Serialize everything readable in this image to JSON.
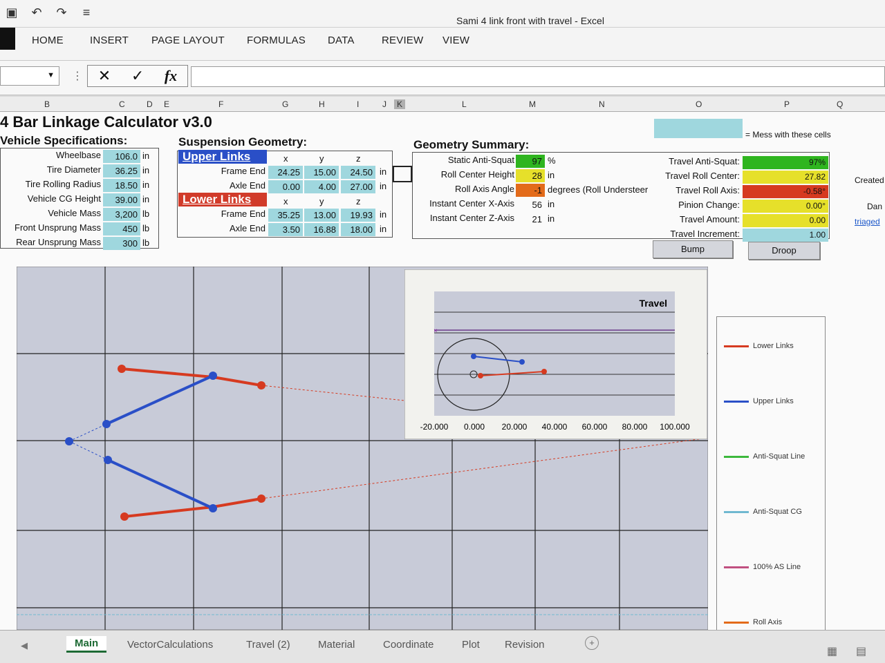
{
  "window": {
    "title": "Sami 4 link front with travel - Excel",
    "qat": [
      "save-icon",
      "undo-icon",
      "redo-icon",
      "customize-icon"
    ]
  },
  "ribbon": {
    "tabs": [
      "HOME",
      "INSERT",
      "PAGE LAYOUT",
      "FORMULAS",
      "DATA",
      "REVIEW",
      "VIEW"
    ]
  },
  "formula_bar": {
    "fx_label": "fx",
    "value": ""
  },
  "columns": [
    "B",
    "C",
    "D",
    "E",
    "F",
    "G",
    "H",
    "I",
    "J",
    "K",
    "L",
    "M",
    "N",
    "O",
    "P",
    "Q"
  ],
  "calculator": {
    "title": "4 Bar Linkage Calculator v3.0",
    "legend_note": "= Mess with these cells",
    "vehicle": {
      "heading": "Vehicle Specifications:",
      "rows": [
        {
          "label": "Wheelbase",
          "value": "106.0",
          "unit": "in"
        },
        {
          "label": "Tire Diameter",
          "value": "36.25",
          "unit": "in"
        },
        {
          "label": "Tire Rolling Radius",
          "value": "18.50",
          "unit": "in"
        },
        {
          "label": "Vehicle CG Height",
          "value": "39.00",
          "unit": "in"
        },
        {
          "label": "Vehicle Mass",
          "value": "3,200",
          "unit": "lb"
        },
        {
          "label": "Front Unsprung Mass",
          "value": "450",
          "unit": "lb"
        },
        {
          "label": "Rear Unsprung Mass",
          "value": "300",
          "unit": "lb"
        }
      ]
    },
    "suspension": {
      "heading": "Suspension Geometry:",
      "upper": {
        "title": "Upper Links",
        "axes": [
          "x",
          "y",
          "z"
        ],
        "rows": [
          {
            "label": "Frame End",
            "values": [
              "24.25",
              "15.00",
              "24.50"
            ],
            "unit": "in"
          },
          {
            "label": "Axle End",
            "values": [
              "0.00",
              "4.00",
              "27.00"
            ],
            "unit": "in"
          }
        ]
      },
      "lower": {
        "title": "Lower Links",
        "axes": [
          "x",
          "y",
          "z"
        ],
        "rows": [
          {
            "label": "Frame End",
            "values": [
              "35.25",
              "13.00",
              "19.93"
            ],
            "unit": "in"
          },
          {
            "label": "Axle End",
            "values": [
              "3.50",
              "16.88",
              "18.00"
            ],
            "unit": "in"
          }
        ]
      }
    },
    "summary": {
      "heading": "Geometry Summary:",
      "rows": [
        {
          "label": "Static Anti-Squat",
          "value": "97",
          "unit": "%",
          "color": "#2fb51f"
        },
        {
          "label": "Roll Center Height",
          "value": "28",
          "unit": "in",
          "color": "#e6e02a"
        },
        {
          "label": "Roll Axis Angle",
          "value": "-1",
          "unit": "degrees (Roll Understeer",
          "color": "#e36b1a"
        },
        {
          "label": "Instant Center X-Axis",
          "value": "56",
          "unit": "in",
          "color": ""
        },
        {
          "label": "Instant Center Z-Axis",
          "value": "21",
          "unit": "in",
          "color": ""
        }
      ]
    },
    "travel": {
      "rows": [
        {
          "label": "Travel Anti-Squat:",
          "value": "97%",
          "color": "#2fb51f"
        },
        {
          "label": "Travel Roll Center:",
          "value": "27.82",
          "color": "#e6e02a"
        },
        {
          "label": "Travel Roll Axis:",
          "value": "-0.58°",
          "color": "#d63a20"
        },
        {
          "label": "Pinion Change:",
          "value": "0.00°",
          "color": "#e6e02a"
        },
        {
          "label": "Travel Amount:",
          "value": "0.00",
          "color": "#e6e02a"
        },
        {
          "label": "Travel Increment:",
          "value": "1.00",
          "color": "#9fd7de"
        }
      ],
      "bump_label": "Bump",
      "droop_label": "Droop"
    },
    "side_text": [
      "Created",
      "Dan",
      "triaged"
    ]
  },
  "travel_chart": {
    "title": "Travel",
    "x_ticks": [
      "-20.000",
      "0.000",
      "20.000",
      "40.000",
      "60.000",
      "80.000",
      "100.000"
    ]
  },
  "legend": {
    "items": [
      {
        "name": "Lower Links",
        "color": "#d63a20"
      },
      {
        "name": "Upper Links",
        "color": "#2a4fc7"
      },
      {
        "name": "Anti-Squat Line",
        "color": "#3cb83c"
      },
      {
        "name": "Anti-Squat CG",
        "color": "#6fb8d0"
      },
      {
        "name": "100% AS Line",
        "color": "#c05080"
      },
      {
        "name": "Roll Axis",
        "color": "#e36b1a"
      }
    ]
  },
  "sheet_tabs": [
    "Main",
    "VectorCalculations",
    "Travel (2)",
    "Material",
    "Coordinate",
    "Plot",
    "Revision"
  ]
}
